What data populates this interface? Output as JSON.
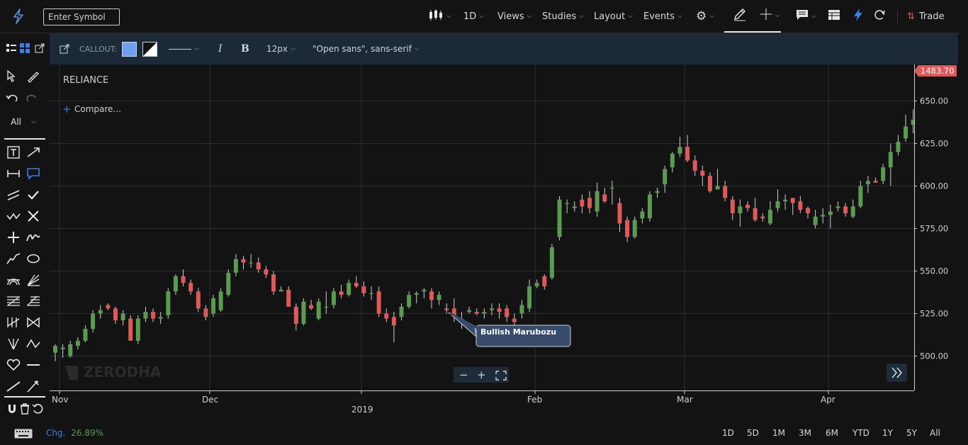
{
  "header": {
    "symbol_placeholder": "Enter Symbol",
    "menus": {
      "interval": "1D",
      "views": "Views",
      "studies": "Studies",
      "layout": "Layout",
      "events": "Events"
    },
    "trade_label": "Trade"
  },
  "drawing_toolbar": {
    "callout_label": "CALLOUT:",
    "fill_color": "#6f9ff0",
    "font_size": "12px",
    "font_family": "\"Open sans\", sans-serif",
    "italic_label": "I",
    "bold_label": "B"
  },
  "left_tools": {
    "filter_label": "All"
  },
  "chart": {
    "symbol": "RELIANCE",
    "compare_label": "Compare...",
    "last_price": "1483.70",
    "watermark": "ZERODHA",
    "annotation": "Bullish Marubozu",
    "colors": {
      "up": "#5a9a51",
      "down": "#e0595a",
      "badge": "#e0595a",
      "grid": "#2a2f33"
    }
  },
  "chart_data": {
    "type": "candlestick",
    "ylim": [
      490,
      668
    ],
    "y_ticks": [
      "650.00",
      "625.00",
      "600.00",
      "575.00",
      "550.00",
      "525.00",
      "500.00"
    ],
    "x_ticks": [
      "Nov",
      "Dec",
      "2019",
      "Feb",
      "Mar",
      "Apr"
    ],
    "candles": [
      [
        502,
        506,
        497,
        507
      ],
      [
        504,
        505,
        499,
        507
      ],
      [
        500,
        507,
        499,
        509
      ],
      [
        506,
        509,
        504,
        511
      ],
      [
        509,
        516,
        508,
        518
      ],
      [
        516,
        525,
        514,
        527
      ],
      [
        525,
        527,
        522,
        530
      ],
      [
        530,
        528,
        527,
        531
      ],
      [
        528,
        521,
        519,
        529
      ],
      [
        521,
        525,
        518,
        527
      ],
      [
        522,
        509,
        509,
        524
      ],
      [
        509,
        522,
        507,
        524
      ],
      [
        522,
        526,
        520,
        529
      ],
      [
        526,
        522,
        520,
        528
      ],
      [
        522,
        523,
        519,
        526
      ],
      [
        524,
        538,
        522,
        540
      ],
      [
        538,
        547,
        536,
        548
      ],
      [
        547,
        543,
        541,
        551
      ],
      [
        543,
        538,
        536,
        545
      ],
      [
        538,
        528,
        526,
        540
      ],
      [
        528,
        523,
        521,
        530
      ],
      [
        525,
        534,
        523,
        536
      ],
      [
        527,
        538,
        526,
        540
      ],
      [
        536,
        549,
        535,
        551
      ],
      [
        549,
        557,
        547,
        560
      ],
      [
        557,
        555,
        551,
        559
      ],
      [
        555,
        555,
        552,
        560
      ],
      [
        555,
        551,
        549,
        558
      ],
      [
        551,
        548,
        546,
        553
      ],
      [
        548,
        538,
        536,
        550
      ],
      [
        538,
        539,
        538,
        541
      ],
      [
        539,
        529,
        529,
        541
      ],
      [
        529,
        519,
        515,
        531
      ],
      [
        519,
        532,
        518,
        534
      ],
      [
        530,
        528,
        527,
        533
      ],
      [
        522,
        532,
        521,
        534
      ],
      [
        529,
        529,
        525,
        538
      ],
      [
        530,
        538,
        528,
        540
      ],
      [
        538,
        536,
        534,
        542
      ],
      [
        536,
        543,
        535,
        545
      ],
      [
        543,
        541,
        540,
        547
      ],
      [
        541,
        537,
        535,
        544
      ],
      [
        537,
        537,
        533,
        541
      ],
      [
        538,
        525,
        523,
        541
      ],
      [
        525,
        522,
        520,
        528
      ],
      [
        523,
        518,
        508,
        526
      ],
      [
        523,
        529,
        521,
        531
      ],
      [
        529,
        536,
        528,
        538
      ],
      [
        536,
        537,
        531,
        538
      ],
      [
        538,
        539,
        534,
        540
      ],
      [
        538,
        533,
        528,
        540
      ],
      [
        533,
        536,
        530,
        538
      ],
      [
        528,
        527,
        525,
        531
      ],
      [
        528,
        523,
        520,
        534
      ],
      [
        520,
        522,
        516,
        526
      ],
      [
        526,
        527,
        525,
        529
      ],
      [
        526,
        525,
        524,
        528
      ],
      [
        525,
        526,
        522,
        528
      ],
      [
        527,
        528,
        524,
        531
      ],
      [
        528,
        526,
        522,
        531
      ],
      [
        528,
        523,
        520,
        530
      ],
      [
        522,
        520,
        518,
        525
      ],
      [
        525,
        530,
        522,
        533
      ],
      [
        528,
        541,
        526,
        545
      ],
      [
        541,
        543,
        540,
        545
      ],
      [
        547,
        541,
        539,
        548
      ],
      [
        546,
        564,
        545,
        566
      ],
      [
        570,
        592,
        568,
        594
      ],
      [
        590,
        590,
        584,
        592
      ],
      [
        587,
        588,
        585,
        591
      ],
      [
        592,
        588,
        584,
        595
      ],
      [
        593,
        587,
        584,
        597
      ],
      [
        585,
        597,
        582,
        602
      ],
      [
        595,
        591,
        590,
        599
      ],
      [
        599,
        599,
        589,
        603
      ],
      [
        590,
        578,
        573,
        593
      ],
      [
        580,
        570,
        567,
        582
      ],
      [
        570,
        580,
        569,
        582
      ],
      [
        581,
        585,
        578,
        587
      ],
      [
        581,
        595,
        579,
        597
      ],
      [
        596,
        597,
        593,
        599
      ],
      [
        601,
        610,
        596,
        612
      ],
      [
        611,
        619,
        608,
        620
      ],
      [
        619,
        623,
        617,
        629
      ],
      [
        623,
        615,
        614,
        630
      ],
      [
        615,
        609,
        606,
        618
      ],
      [
        609,
        606,
        600,
        612
      ],
      [
        606,
        597,
        596,
        608
      ],
      [
        598,
        600,
        598,
        610
      ],
      [
        600,
        593,
        591,
        603
      ],
      [
        592,
        584,
        580,
        594
      ],
      [
        584,
        588,
        576,
        592
      ],
      [
        589,
        587,
        585,
        591
      ],
      [
        587,
        580,
        579,
        593
      ],
      [
        582,
        581,
        579,
        584
      ],
      [
        578,
        586,
        577,
        591
      ],
      [
        587,
        591,
        585,
        598
      ],
      [
        591,
        592,
        586,
        595
      ],
      [
        593,
        590,
        583,
        593
      ],
      [
        591,
        586,
        584,
        594
      ],
      [
        587,
        584,
        581,
        588
      ],
      [
        577,
        582,
        575,
        586
      ],
      [
        582,
        583,
        578,
        587
      ],
      [
        583,
        585,
        575,
        589
      ],
      [
        587,
        588,
        585,
        591
      ],
      [
        588,
        584,
        582,
        590
      ],
      [
        582,
        588,
        581,
        592
      ],
      [
        588,
        600,
        587,
        603
      ],
      [
        601,
        603,
        596,
        606
      ],
      [
        603,
        602,
        602,
        605
      ],
      [
        603,
        611,
        601,
        613
      ],
      [
        611,
        620,
        600,
        625
      ],
      [
        620,
        626,
        618,
        630
      ],
      [
        628,
        635,
        626,
        642
      ],
      [
        636,
        639,
        631,
        645
      ],
      [
        633,
        640,
        630,
        643
      ],
      [
        642,
        638,
        634,
        644
      ],
      [
        640,
        631,
        624,
        647
      ],
      [
        632,
        636,
        626,
        648
      ],
      [
        637,
        650,
        634,
        652
      ],
      [
        652,
        655,
        647,
        660
      ],
      [
        656,
        648,
        648,
        660
      ],
      [
        648,
        639,
        632,
        655
      ],
      [
        640,
        638,
        629,
        642
      ],
      [
        635,
        651,
        633,
        656
      ],
      [
        653,
        660,
        645,
        662
      ],
      [
        658,
        647,
        644,
        662
      ],
      [
        647,
        650,
        643,
        653
      ],
      [
        651,
        653,
        643,
        655
      ],
      [
        654,
        664,
        642,
        665
      ],
      [
        666,
        661,
        663,
        668
      ],
      [
        664,
        656,
        655,
        666
      ],
      [
        656,
        661,
        649,
        664
      ],
      [
        661,
        654,
        649,
        664
      ],
      [
        654,
        647,
        636,
        656
      ],
      [
        649,
        651,
        640,
        652
      ],
      [
        652,
        636,
        631,
        653
      ],
      [
        636,
        637,
        631,
        643
      ],
      [
        637,
        634,
        630,
        642
      ],
      [
        634,
        640,
        632,
        640
      ],
      [
        636,
        635,
        627,
        645
      ],
      [
        638,
        640,
        633,
        645
      ],
      [
        642,
        643,
        639,
        647
      ],
      [
        643,
        639,
        634,
        645
      ],
      [
        641,
        640,
        634,
        641
      ]
    ]
  },
  "range_bar": {
    "change_label": "Chg.",
    "change_value": "26.89%",
    "ranges": [
      "1D",
      "5D",
      "1M",
      "3M",
      "6M",
      "YTD",
      "1Y",
      "5Y",
      "All"
    ]
  }
}
